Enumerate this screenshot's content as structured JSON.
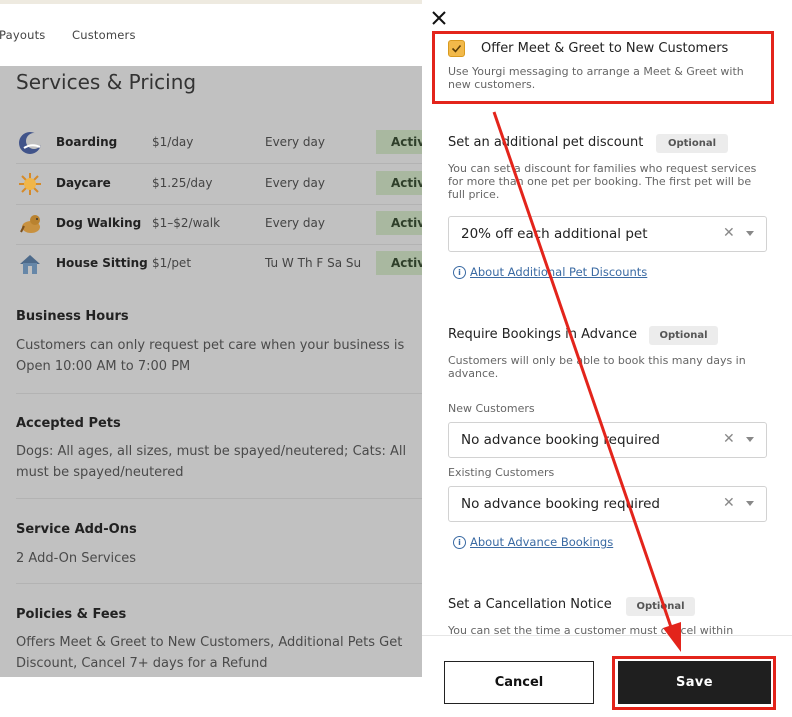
{
  "nav": {
    "payouts": "Payouts",
    "customers": "Customers"
  },
  "page": {
    "title": "Services & Pricing"
  },
  "services": [
    {
      "name": "Boarding",
      "price": "$1/day",
      "schedule": "Every day",
      "status": "Active",
      "icon": "moon-icon"
    },
    {
      "name": "Daycare",
      "price": "$1.25/day",
      "schedule": "Every day",
      "status": "Active",
      "icon": "sun-icon"
    },
    {
      "name": "Dog Walking",
      "price": "$1–$2/walk",
      "schedule": "Every day",
      "status": "Active",
      "icon": "dog-icon"
    },
    {
      "name": "House Sitting",
      "price": "$1/pet",
      "schedule": "Tu W Th F Sa Su",
      "status": "Active",
      "icon": "house-icon"
    }
  ],
  "sections": {
    "business_hours": {
      "heading": "Business Hours",
      "line1": "Customers can only request pet care when your business is",
      "line2": "Open 10:00 AM to 7:00 PM"
    },
    "accepted_pets": {
      "heading": "Accepted Pets",
      "line1": "Dogs: All ages, all sizes, must be spayed/neutered; Cats: All",
      "line2": "must be spayed/neutered"
    },
    "addons": {
      "heading": "Service Add-Ons",
      "line1": "2 Add-On Services"
    },
    "policies": {
      "heading": "Policies & Fees",
      "line1": "Offers Meet & Greet to New Customers, Additional Pets Get",
      "line2": "Discount, Cancel 7+ days for a Refund"
    }
  },
  "drawer": {
    "close_icon": "close-icon",
    "meet_greet": {
      "checked": true,
      "label": "Offer Meet & Greet to New Customers",
      "help": "Use Yourgi messaging to arrange a Meet & Greet with new customers."
    },
    "discount": {
      "heading": "Set an additional pet discount",
      "badge": "Optional",
      "help": "You can set a discount for families who request services for more than one pet per booking. The first pet will be full price.",
      "value": "20% off each additional pet",
      "link": "About Additional Pet Discounts"
    },
    "advance": {
      "heading": "Require Bookings in Advance",
      "badge": "Optional",
      "help": "Customers will only be able to book this many days in advance.",
      "new_label": "New Customers",
      "new_value": "No advance booking required",
      "existing_label": "Existing Customers",
      "existing_value": "No advance booking required",
      "link": "About Advance Bookings"
    },
    "cancellation": {
      "heading": "Set a Cancellation Notice",
      "badge": "Optional",
      "help": "You can set the time a customer must cancel within"
    },
    "footer": {
      "cancel": "Cancel",
      "save": "Save"
    }
  },
  "colors": {
    "annotation": "#e3241b",
    "accent": "#f2b94a",
    "overlay": "#c1c1c1"
  }
}
